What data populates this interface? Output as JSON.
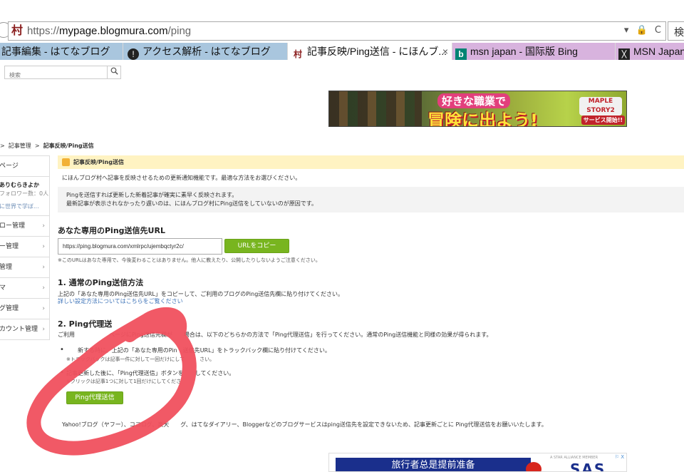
{
  "browser": {
    "url_scheme": "https://",
    "url_host": "mypage.blogmura.com",
    "url_path": "/ping",
    "search_label": "検",
    "addr_icons": [
      "▾",
      "🔒",
      "C"
    ],
    "tabs": [
      {
        "title": "記事編集 - はてなブログ",
        "icon": "hatena-icon"
      },
      {
        "title": "アクセス解析 - はてなブログ",
        "icon": "hatena-icon"
      },
      {
        "title": "記事反映/Ping送信 - にほんブ...",
        "icon": "blogmura-icon",
        "active": true,
        "close": "×"
      },
      {
        "title": "msn japan - 国际版 Bing",
        "icon": "bing-icon"
      },
      {
        "title": "MSN Japan",
        "icon": "msn-icon"
      }
    ]
  },
  "page_search": {
    "placeholder": "検索",
    "icon": "magnifier-icon"
  },
  "banner": {
    "line1": "好きな職業で",
    "line2": "冒険に出よう!",
    "logo": "MAPLE STORY2",
    "logo_sub": "サービス開始!!"
  },
  "breadcrumb": {
    "sep1": ">",
    "item1": "記事管理",
    "sep2": ">",
    "current": "記事反映/Ping送信"
  },
  "sidebar": {
    "top": "ページ",
    "profile": {
      "name": "ありむらきよか",
      "followers": "フォロワー数：0人",
      "link": "に世界で学ぼ..."
    },
    "items": [
      {
        "label": "ロー管理",
        "chev": "›"
      },
      {
        "label": "ー管理",
        "chev": "›"
      },
      {
        "label": "管理",
        "chev": "›"
      },
      {
        "label": "マ",
        "chev": "›"
      },
      {
        "label": "グ管理",
        "chev": "›"
      },
      {
        "label": "カウント管理",
        "chev": "›"
      }
    ]
  },
  "main": {
    "header": "記事反映/Ping送信",
    "intro": "にほんブログ村へ記事を反映させるための更新通知機能です。最適な方法をお選びください。",
    "notice_line1": "Pingを送信すれば更新した新着記事が確実に素早く反映されます。",
    "notice_line2": "最新記事が表示されなかったり遅いのは、にほんブログ村にPing送信をしていないのが原因です。",
    "ping_url_heading": "あなた専用のPing送信先URL",
    "ping_url_value": "https://ping.blogmura.com/xmlrpc/ujembqctyr2c/",
    "copy_button": "URLをコピー",
    "ping_url_note": "※このURLはあなた専用で、今後変わることはありません。他人に教えたり、公開したりしないようご注意ください。",
    "section1_heading": "1. 通常のPing送信方法",
    "section1_text": "上記の「あなた専用のPing送信先URL」をコピーして、ご利用のブログのPing送信先欄に貼り付けてください。",
    "section1_link": "詳しい設定方法についてはこちらをご覧ください",
    "section2_heading": "2. Ping代理送",
    "section2_text": "ご利用　　　　　　ページにPing送信先欄が　　場合は、以下のどちらかの方法で「Ping代理送信」を行ってください。通常のPing送信機能と同様の効果が得られます。",
    "bullet1": "　　新する時に、上記の「あなた専用のPin　送信先URL」をトラックバック欄に貼り付けてください。",
    "bullet1_note": "※トラックバックは記事一件に対して一回だけにして　　　さい。",
    "bullet2": "記事更新した後に、「Ping代理送信」ボタンを　　してください。",
    "bullet2_note": "※クリックは記事1つに対して1回だけにしてくださ",
    "proxy_button": "Ping代理送信",
    "footer_text": "Yahoo!ブログ（ヤフー）、ココログ、楽天　　グ、はてなダイアリー、Bloggerなどのブログサービスはping送信先を設定できないため、記事更新ごとに Ping代理送信をお願いいたします。"
  },
  "ad_bottom": {
    "text": "旅行者总是提前准备",
    "brand": "SAS",
    "tiny": "A STAR ALLIANCE MEMBER",
    "close": "⚐ X"
  },
  "colors": {
    "accent_green": "#78b51f",
    "header_yellow": "#fff3c2",
    "link_blue": "#3d73b8",
    "annotation_red": "#f0505e"
  }
}
